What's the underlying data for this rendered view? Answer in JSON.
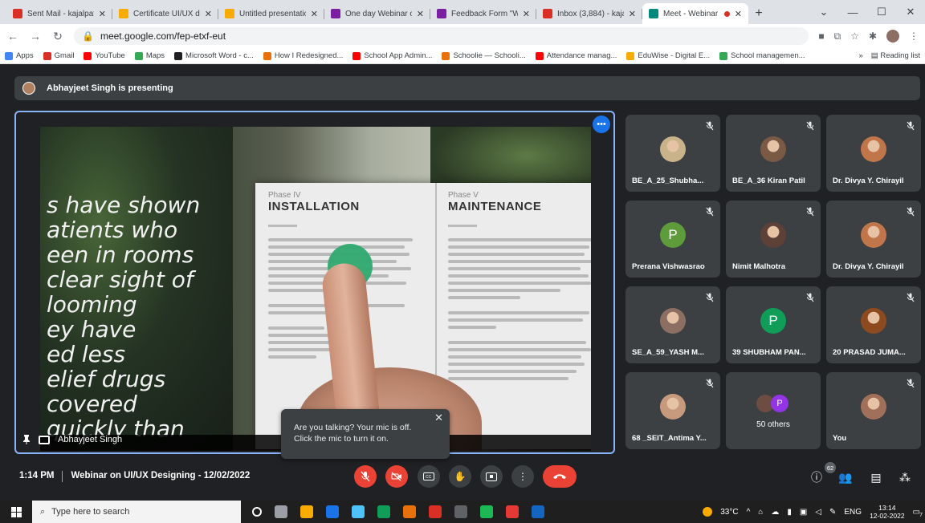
{
  "browser": {
    "tabs": [
      {
        "title": "Sent Mail - kajalpatel",
        "favicon_color": "#d93025",
        "active": false
      },
      {
        "title": "Certificate UI/UX design",
        "favicon_color": "#f9ab00",
        "active": false
      },
      {
        "title": "Untitled presentation",
        "favicon_color": "#f9ab00",
        "active": false
      },
      {
        "title": "One day Webinar on",
        "favicon_color": "#7b1fa2",
        "active": false
      },
      {
        "title": "Feedback Form \"Wel",
        "favicon_color": "#7b1fa2",
        "active": false
      },
      {
        "title": "Inbox (3,884) - kajal",
        "favicon_color": "#d93025",
        "active": false
      },
      {
        "title": "Meet - Webinar",
        "favicon_color": "#00897b",
        "active": true
      }
    ],
    "url": "meet.google.com/fep-etxf-eut",
    "bookmarks": [
      {
        "label": "Apps",
        "color": "#4285f4"
      },
      {
        "label": "Gmail",
        "color": "#d93025"
      },
      {
        "label": "YouTube",
        "color": "#ff0000"
      },
      {
        "label": "Maps",
        "color": "#34a853"
      },
      {
        "label": "Microsoft Word - c...",
        "color": "#202124"
      },
      {
        "label": "How I Redesigned...",
        "color": "#e8710a"
      },
      {
        "label": "School App Admin...",
        "color": "#ff0000"
      },
      {
        "label": "Schoolie — Schooli...",
        "color": "#e8710a"
      },
      {
        "label": "Attendance manag...",
        "color": "#ff0000"
      },
      {
        "label": "EduWise - Digital E...",
        "color": "#f9ab00"
      },
      {
        "label": "School managemen...",
        "color": "#34a853"
      }
    ],
    "reading_list": "Reading list"
  },
  "meet": {
    "presenting": "Abhayjeet Singh is presenting",
    "presenter_label": "Abhayjeet Singh",
    "slide": {
      "quote_lines": [
        "s have shown",
        "atients who",
        "een in rooms",
        "clear sight of",
        "looming",
        "ey have",
        "ed less",
        "elief drugs",
        "covered",
        "quickly than"
      ],
      "left_phase": "Phase IV",
      "left_title": "INSTALLATION",
      "right_phase": "Phase V",
      "right_title": "MAINTENANCE"
    },
    "mic_tooltip": {
      "line1": "Are you talking? Your mic is off.",
      "line2": "Click the mic to turn it on."
    },
    "participants": [
      {
        "name": "BE_A_25_Shubha...",
        "type": "photo",
        "color": "#c9b38a"
      },
      {
        "name": "BE_A_36 Kiran Patil",
        "type": "photo",
        "color": "#7a5a44"
      },
      {
        "name": "Dr. Divya Y. Chirayil",
        "type": "photo",
        "color": "#c0754a"
      },
      {
        "name": "Prerana Vishwasrao",
        "type": "letter",
        "letter": "P",
        "color": "#5e9b3a"
      },
      {
        "name": "Nimit Malhotra",
        "type": "photo",
        "color": "#5d4037"
      },
      {
        "name": "Dr. Divya Y. Chirayil",
        "type": "photo",
        "color": "#c0754a"
      },
      {
        "name": "SE_A_59_YASH M...",
        "type": "photo",
        "color": "#8d6e63"
      },
      {
        "name": "39 SHUBHAM PAN...",
        "type": "letter",
        "letter": "P",
        "color": "#0f9d58"
      },
      {
        "name": "20 PRASAD JUMA...",
        "type": "photo",
        "color": "#8e4a1f"
      },
      {
        "name": "68 _SEIT_Antima Y...",
        "type": "photo",
        "color": "#c79a7e"
      },
      {
        "name": "50 others",
        "type": "others",
        "letter": "P"
      },
      {
        "name": "You",
        "type": "photo",
        "color": "#a0705a"
      }
    ],
    "time": "1:14 PM",
    "meeting_title": "Webinar on UI/UX Designing - 12/02/2022",
    "people_count": "62"
  },
  "taskbar": {
    "search_placeholder": "Type here to search",
    "temperature": "33°C",
    "language": "ENG",
    "time": "13:14",
    "date": "12-02-2022",
    "notification_count": "7"
  }
}
